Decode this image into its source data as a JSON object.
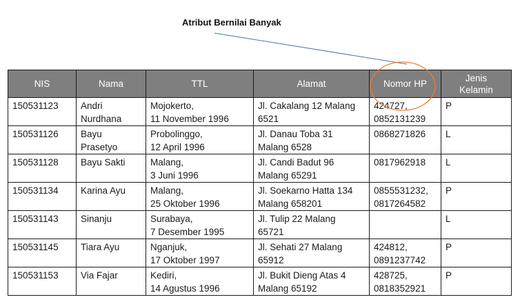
{
  "annotation": {
    "label": "Atribut Bernilai Banyak"
  },
  "table": {
    "headers": {
      "nis": "NIS",
      "nama": "Nama",
      "ttl": "TTL",
      "alamat": "Alamat",
      "hp": "Nomor HP",
      "jk": "Jenis\nKelamin"
    },
    "rows": [
      {
        "nis": "150531123",
        "nama": "Andri\nNurdhana",
        "ttl": "Mojokerto,\n11 November 1996",
        "alamat": "Jl. Cakalang 12 Malang\n6521",
        "hp": "424727,\n0852131239",
        "jk": "P"
      },
      {
        "nis": "150531126",
        "nama": "Bayu\nPrasetyo",
        "ttl": "Probolinggo,\n12 April 1996",
        "alamat": "Jl. Danau Toba 31\nMalang 6528",
        "hp": "0868271826",
        "jk": "L"
      },
      {
        "nis": "150531128",
        "nama": "Bayu Sakti",
        "ttl": "Malang,\n3 Juni 1996",
        "alamat": "Jl. Candi Badut 96\nMalang 65291",
        "hp": "0817962918",
        "jk": "L"
      },
      {
        "nis": "150531134",
        "nama": "Karina Ayu",
        "ttl": "Malang,\n25 Oktober 1996",
        "alamat": "Jl. Soekarno Hatta 134\nMalang 658201",
        "hp": "0855531232,\n0817264582",
        "jk": "P"
      },
      {
        "nis": "150531143",
        "nama": "Sinanju",
        "ttl": "Surabaya,\n7 Desember 1995",
        "alamat": "Jl. Tulip 22 Malang\n65721",
        "hp": "",
        "jk": "L"
      },
      {
        "nis": "150531145",
        "nama": "Tiara Ayu",
        "ttl": "Nganjuk,\n17 Oktober 1997",
        "alamat": "Jl. Sehati 27 Malang\n65912",
        "hp": "424812,\n0891237742",
        "jk": "P"
      },
      {
        "nis": "150531153",
        "nama": "Via Fajar",
        "ttl": "Kediri,\n14 Agustus 1996",
        "alamat": "Jl. Bukit Dieng Atas 4\nMalang 65192",
        "hp": "428725,\n0818352921",
        "jk": "P"
      }
    ]
  },
  "colors": {
    "header_bg": "#7f7f7f",
    "highlight_circle": "#ed7d31",
    "pointer_line": "#4a72b0"
  }
}
